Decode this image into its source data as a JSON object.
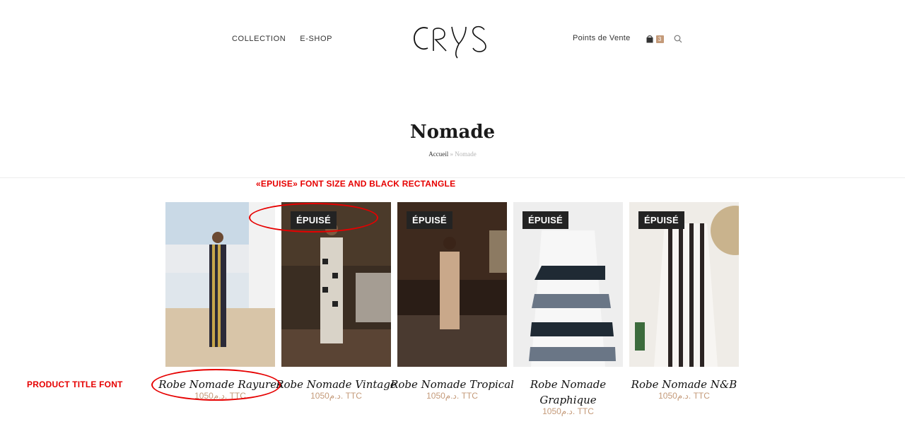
{
  "header": {
    "nav_left": [
      "COLLECTION",
      "E-SHOP"
    ],
    "logo_text": "CRYS",
    "points_de_vente": "Points de Vente",
    "cart_count": "3",
    "icons": [
      "cart-icon",
      "search-icon"
    ]
  },
  "page": {
    "title": "Nomade",
    "breadcrumb": {
      "home": "Accueil",
      "sep": "»",
      "current": "Nomade"
    }
  },
  "annotations": {
    "epuise_note": "«EPUISE» FONT SIZE AND BLACK RECTANGLE",
    "title_note": "PRODUCT TITLE FONT"
  },
  "products": [
    {
      "title": "Robe Nomade Rayures",
      "price": "1050د.م. TTC",
      "badge": "",
      "colors": [
        "#8aa7c1",
        "#d9cfb8",
        "#2b2a38"
      ]
    },
    {
      "title": "Robe Nomade Vintage",
      "price": "1050د.م. TTC",
      "badge": "ÉPUISÉ",
      "colors": [
        "#5a4a3a",
        "#2c241d",
        "#a39b91"
      ]
    },
    {
      "title": "Robe Nomade Tropical",
      "price": "1050د.م. TTC",
      "badge": "ÉPUISÉ",
      "colors": [
        "#3e2a1e",
        "#1a1210",
        "#c9a88a"
      ]
    },
    {
      "title": "Robe Nomade Graphique",
      "price": "1050د.م. TTC",
      "badge": "ÉPUISÉ",
      "colors": [
        "#f3f3f3",
        "#6a7686",
        "#1f2a34"
      ]
    },
    {
      "title": "Robe Nomade N&B",
      "price": "1050د.م. TTC",
      "badge": "ÉPUISÉ",
      "colors": [
        "#f1efec",
        "#2b2423",
        "#c9b38d"
      ]
    }
  ]
}
